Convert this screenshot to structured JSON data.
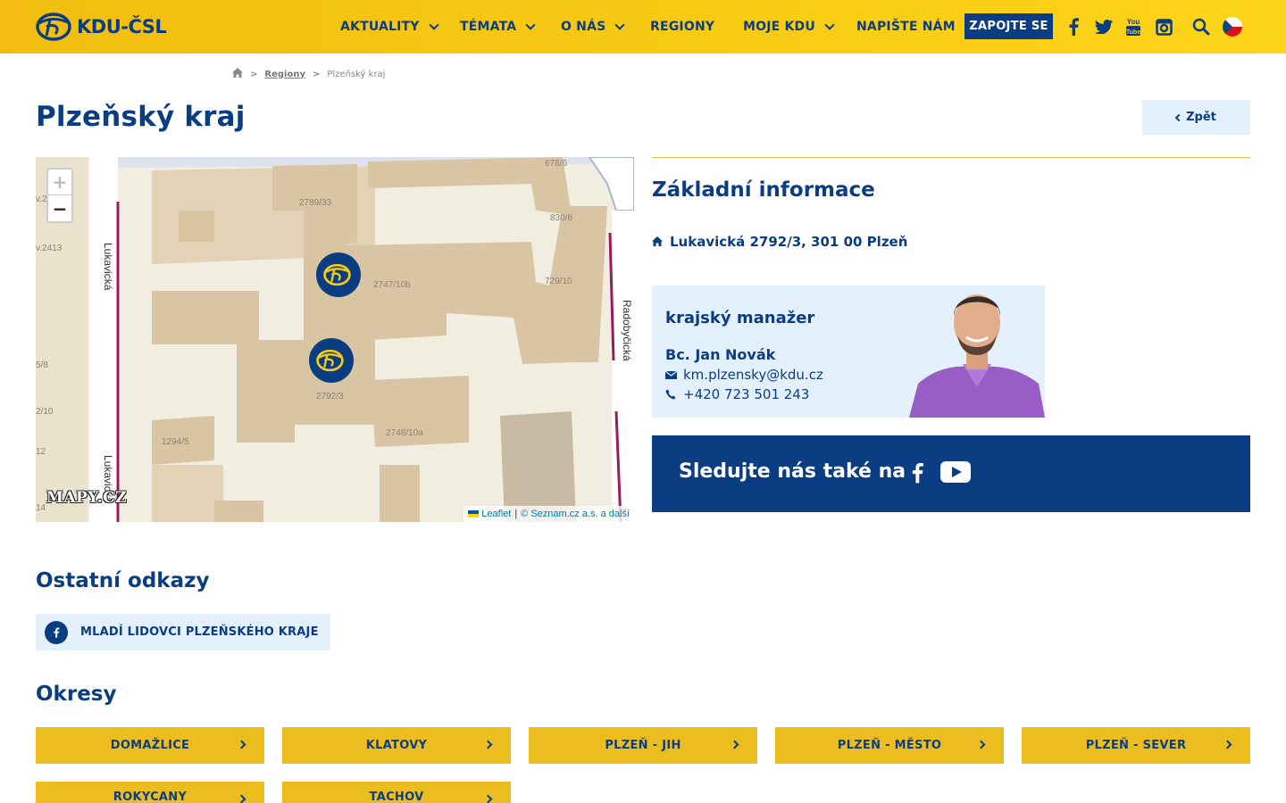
{
  "header": {
    "logo_text": "KDU-ČSL",
    "nav": [
      {
        "label": "AKTUALITY",
        "has_dropdown": true
      },
      {
        "label": "TÉMATA",
        "has_dropdown": true
      },
      {
        "label": "O NÁS",
        "has_dropdown": true
      },
      {
        "label": "REGIONY",
        "has_dropdown": false
      },
      {
        "label": "MOJE KDU",
        "has_dropdown": true
      },
      {
        "label": "NAPIŠTE NÁM",
        "has_dropdown": false
      }
    ],
    "cta_label": "ZAPOJTE SE",
    "icons": [
      "facebook-icon",
      "twitter-icon",
      "youtube-icon",
      "instagram-icon",
      "search-icon",
      "czech-flag-icon"
    ]
  },
  "breadcrumb": {
    "home_icon": "home-icon",
    "items": [
      "Regiony",
      "Plzeňský kraj"
    ],
    "separator": ">"
  },
  "page": {
    "title": "Plzeňský kraj",
    "back_label": "Zpět"
  },
  "map": {
    "zoom_in": "+",
    "zoom_out": "−",
    "provider_logo": "MAPY.CZ",
    "attribution_leaflet": "Leaflet",
    "attribution_sep": "|",
    "attribution_source": "© Seznam.cz a.s. a další",
    "streets": [
      "Lukavická",
      "Radobyčická",
      "Lukavická"
    ],
    "parcel_labels": [
      "678/6",
      "2789/33",
      "830/8",
      "2747/10b",
      "729/10",
      "2792/3",
      "1294/5",
      "2748/10a",
      "v.2413",
      "v.2",
      "5/8",
      "2/10",
      "12",
      "14"
    ],
    "markers": 2
  },
  "info": {
    "section_title": "Základní informace",
    "address": "Lukavická 2792/3, 301 00 Plzeň",
    "manager": {
      "role": "krajský manažer",
      "name": "Bc. Jan Novák",
      "email": "km.plzensky@kdu.cz",
      "phone": "+420 723 501 243"
    },
    "follow_label": "Sledujte nás také na",
    "follow_icons": [
      "facebook-icon",
      "youtube-icon"
    ]
  },
  "other_links": {
    "title": "Ostatní odkazy",
    "items": [
      {
        "label": "MLADÍ LIDOVCI PLZEŇSKÉHO KRAJE",
        "icon": "facebook-icon"
      }
    ]
  },
  "districts": {
    "title": "Okresy",
    "items": [
      "DOMAŽLICE",
      "KLATOVY",
      "PLZEŇ - JIH",
      "PLZEŇ - MĚSTO",
      "PLZEŇ - SEVER",
      "ROKYCANY",
      "TACHOV"
    ]
  },
  "colors": {
    "brand_blue": "#0a3d82",
    "brand_yellow": "#f7cb14",
    "light_blue_bg": "#e4f0fb",
    "district_yellow": "#ebbd1f"
  }
}
